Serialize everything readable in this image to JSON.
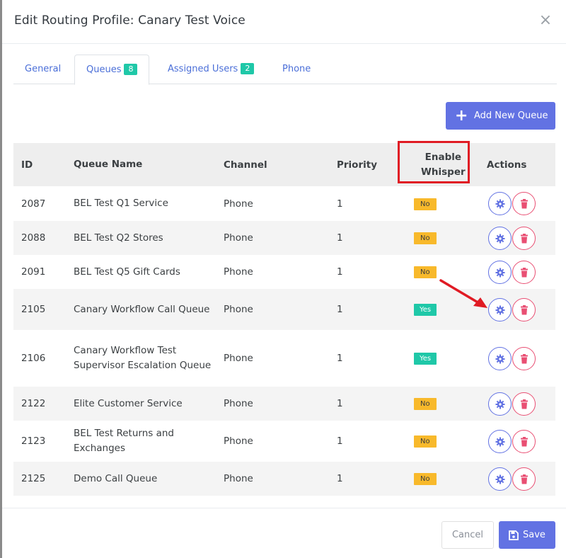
{
  "modal": {
    "title": "Edit Routing Profile: Canary Test Voice",
    "close_glyph": "×"
  },
  "tabs": [
    {
      "label": "General",
      "badge": null,
      "active": false
    },
    {
      "label": "Queues",
      "badge": "8",
      "active": true
    },
    {
      "label": "Assigned Users",
      "badge": "2",
      "active": false
    },
    {
      "label": "Phone",
      "badge": null,
      "active": false
    }
  ],
  "toolbar": {
    "add_label": "Add New Queue",
    "add_icon": "plus-icon"
  },
  "table": {
    "headers": {
      "id": "ID",
      "name": "Queue Name",
      "channel": "Channel",
      "priority": "Priority",
      "whisper_line1": "Enable",
      "whisper_line2": "Whisper",
      "actions": "Actions"
    },
    "rows": [
      {
        "id": "2087",
        "name": "BEL Test Q1 Service",
        "channel": "Phone",
        "priority": "1",
        "whisper": "No"
      },
      {
        "id": "2088",
        "name": "BEL Test Q2 Stores",
        "channel": "Phone",
        "priority": "1",
        "whisper": "No"
      },
      {
        "id": "2091",
        "name": "BEL Test Q5 Gift Cards",
        "channel": "Phone",
        "priority": "1",
        "whisper": "No"
      },
      {
        "id": "2105",
        "name": "Canary Workflow Call Queue",
        "channel": "Phone",
        "priority": "1",
        "whisper": "Yes"
      },
      {
        "id": "2106",
        "name": "Canary Workflow Test Supervisor Escalation Queue",
        "channel": "Phone",
        "priority": "1",
        "whisper": "Yes"
      },
      {
        "id": "2122",
        "name": "Elite Customer Service",
        "channel": "Phone",
        "priority": "1",
        "whisper": "No"
      },
      {
        "id": "2123",
        "name": "BEL Test Returns and Exchanges",
        "channel": "Phone",
        "priority": "1",
        "whisper": "No"
      },
      {
        "id": "2125",
        "name": "Demo Call Queue",
        "channel": "Phone",
        "priority": "1",
        "whisper": "No"
      }
    ]
  },
  "footer": {
    "cancel_label": "Cancel",
    "save_label": "Save"
  },
  "colors": {
    "primary": "#6272e3",
    "teal": "#1fc8a8",
    "warning": "#f8b92b",
    "danger": "#e94f73",
    "annotation_red": "#e01b24"
  }
}
